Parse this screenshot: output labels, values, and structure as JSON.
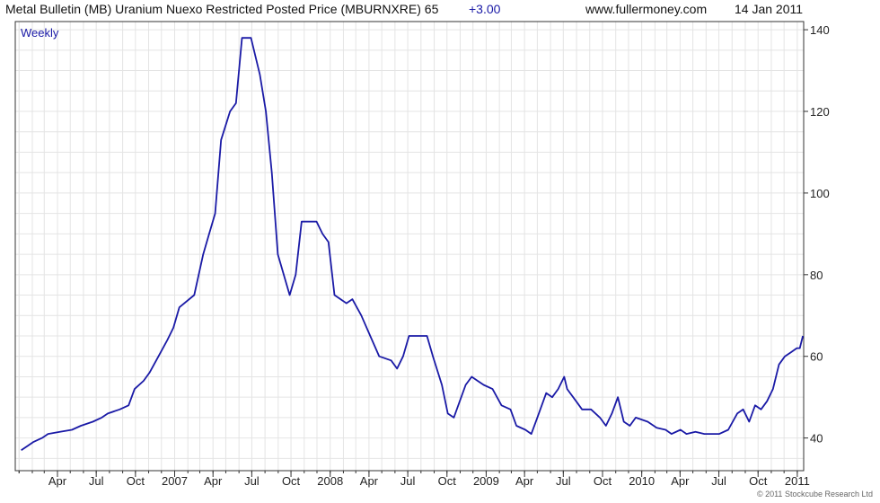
{
  "header": {
    "title": "Metal Bulletin (MB) Uranium Nuexo Restricted Posted Price (MBURNXRE) 65",
    "change": "+3.00",
    "website": "www.fullermoney.com",
    "date": "14 Jan 2011"
  },
  "copyright": "© 2011 Stockcube Research Ltd",
  "colors": {
    "line": "#1a1aa6",
    "change": "#1a1aa6",
    "frame": "#333333",
    "grid": "#e4e4e4"
  },
  "chart_data": {
    "type": "line",
    "frequency_label": "Weekly",
    "series": [
      {
        "points": [
          [
            "2006-01-06",
            37
          ],
          [
            "2006-01-20",
            38
          ],
          [
            "2006-02-03",
            39
          ],
          [
            "2006-02-24",
            40
          ],
          [
            "2006-03-10",
            41
          ],
          [
            "2006-04-07",
            41.5
          ],
          [
            "2006-05-05",
            42
          ],
          [
            "2006-05-26",
            43
          ],
          [
            "2006-06-23",
            44
          ],
          [
            "2006-07-14",
            45
          ],
          [
            "2006-07-28",
            46
          ],
          [
            "2006-08-25",
            47
          ],
          [
            "2006-09-15",
            48
          ],
          [
            "2006-09-29",
            52
          ],
          [
            "2006-10-20",
            54
          ],
          [
            "2006-11-03",
            56
          ],
          [
            "2006-11-24",
            60
          ],
          [
            "2006-12-15",
            64
          ],
          [
            "2006-12-29",
            67
          ],
          [
            "2007-01-12",
            72
          ],
          [
            "2007-02-16",
            75
          ],
          [
            "2007-03-09",
            85
          ],
          [
            "2007-03-23",
            90
          ],
          [
            "2007-04-06",
            95
          ],
          [
            "2007-04-20",
            113
          ],
          [
            "2007-05-11",
            120
          ],
          [
            "2007-05-25",
            122
          ],
          [
            "2007-06-08",
            138
          ],
          [
            "2007-06-29",
            138
          ],
          [
            "2007-07-06",
            135
          ],
          [
            "2007-07-20",
            129
          ],
          [
            "2007-08-03",
            120
          ],
          [
            "2007-08-17",
            105
          ],
          [
            "2007-08-31",
            85
          ],
          [
            "2007-09-28",
            75
          ],
          [
            "2007-10-12",
            80
          ],
          [
            "2007-10-26",
            93
          ],
          [
            "2007-11-30",
            93
          ],
          [
            "2007-12-14",
            90
          ],
          [
            "2007-12-28",
            88
          ],
          [
            "2008-01-11",
            75
          ],
          [
            "2008-02-08",
            73
          ],
          [
            "2008-02-22",
            74
          ],
          [
            "2008-03-14",
            70
          ],
          [
            "2008-04-04",
            65
          ],
          [
            "2008-04-25",
            60
          ],
          [
            "2008-05-23",
            59
          ],
          [
            "2008-06-06",
            57
          ],
          [
            "2008-06-20",
            60
          ],
          [
            "2008-07-04",
            65
          ],
          [
            "2008-08-15",
            65
          ],
          [
            "2008-08-29",
            60
          ],
          [
            "2008-09-19",
            53
          ],
          [
            "2008-10-03",
            46
          ],
          [
            "2008-10-17",
            45
          ],
          [
            "2008-10-31",
            49
          ],
          [
            "2008-11-14",
            53
          ],
          [
            "2008-11-28",
            55
          ],
          [
            "2008-12-12",
            54
          ],
          [
            "2008-12-26",
            53
          ],
          [
            "2009-01-16",
            52
          ],
          [
            "2009-02-06",
            48
          ],
          [
            "2009-02-27",
            47
          ],
          [
            "2009-03-13",
            43
          ],
          [
            "2009-04-03",
            42
          ],
          [
            "2009-04-17",
            41
          ],
          [
            "2009-05-01",
            45
          ],
          [
            "2009-05-22",
            51
          ],
          [
            "2009-06-05",
            50
          ],
          [
            "2009-06-19",
            52
          ],
          [
            "2009-07-03",
            55
          ],
          [
            "2009-07-10",
            52
          ],
          [
            "2009-07-31",
            49
          ],
          [
            "2009-08-14",
            47
          ],
          [
            "2009-09-04",
            47
          ],
          [
            "2009-09-25",
            45
          ],
          [
            "2009-10-09",
            43
          ],
          [
            "2009-10-23",
            46
          ],
          [
            "2009-11-06",
            50
          ],
          [
            "2009-11-20",
            44
          ],
          [
            "2009-12-04",
            43
          ],
          [
            "2009-12-18",
            45
          ],
          [
            "2010-01-15",
            44
          ],
          [
            "2010-02-05",
            42.5
          ],
          [
            "2010-02-26",
            42
          ],
          [
            "2010-03-12",
            41
          ],
          [
            "2010-04-02",
            42
          ],
          [
            "2010-04-16",
            41
          ],
          [
            "2010-05-07",
            41.5
          ],
          [
            "2010-05-28",
            41
          ],
          [
            "2010-06-11",
            41
          ],
          [
            "2010-07-02",
            41
          ],
          [
            "2010-07-23",
            42
          ],
          [
            "2010-08-13",
            46
          ],
          [
            "2010-08-27",
            47
          ],
          [
            "2010-09-10",
            44
          ],
          [
            "2010-09-24",
            48
          ],
          [
            "2010-10-08",
            47
          ],
          [
            "2010-10-22",
            49
          ],
          [
            "2010-11-05",
            52
          ],
          [
            "2010-11-19",
            58
          ],
          [
            "2010-12-03",
            60
          ],
          [
            "2010-12-17",
            61
          ],
          [
            "2010-12-31",
            62
          ],
          [
            "2011-01-07",
            62
          ],
          [
            "2011-01-14",
            65
          ]
        ]
      }
    ],
    "y_axis": {
      "side": "right",
      "min": 32,
      "max": 142,
      "ticks": [
        40,
        60,
        80,
        100,
        120,
        140
      ]
    },
    "x_axis": {
      "min": "2005-12-23",
      "max": "2011-01-16",
      "ticks": [
        {
          "date": "2006-04-01",
          "label": "Apr"
        },
        {
          "date": "2006-07-01",
          "label": "Jul"
        },
        {
          "date": "2006-10-01",
          "label": "Oct"
        },
        {
          "date": "2007-01-01",
          "label": "2007"
        },
        {
          "date": "2007-04-01",
          "label": "Apr"
        },
        {
          "date": "2007-07-01",
          "label": "Jul"
        },
        {
          "date": "2007-10-01",
          "label": "Oct"
        },
        {
          "date": "2008-01-01",
          "label": "2008"
        },
        {
          "date": "2008-04-01",
          "label": "Apr"
        },
        {
          "date": "2008-07-01",
          "label": "Jul"
        },
        {
          "date": "2008-10-01",
          "label": "Oct"
        },
        {
          "date": "2009-01-01",
          "label": "2009"
        },
        {
          "date": "2009-04-01",
          "label": "Apr"
        },
        {
          "date": "2009-07-01",
          "label": "Jul"
        },
        {
          "date": "2009-10-01",
          "label": "Oct"
        },
        {
          "date": "2010-01-01",
          "label": "2010"
        },
        {
          "date": "2010-04-01",
          "label": "Apr"
        },
        {
          "date": "2010-07-01",
          "label": "Jul"
        },
        {
          "date": "2010-10-01",
          "label": "Oct"
        },
        {
          "date": "2011-01-01",
          "label": "2011"
        }
      ]
    },
    "grid": true
  }
}
